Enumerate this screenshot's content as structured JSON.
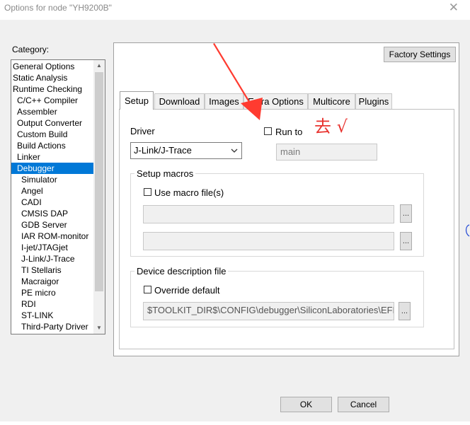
{
  "window": {
    "title": "Options for node \"YH9200B\"",
    "close_symbol": "✕"
  },
  "category": {
    "label": "Category:",
    "items": [
      {
        "label": "General Options",
        "indent": 0
      },
      {
        "label": "Static Analysis",
        "indent": 0
      },
      {
        "label": "Runtime Checking",
        "indent": 0
      },
      {
        "label": "C/C++ Compiler",
        "indent": 1
      },
      {
        "label": "Assembler",
        "indent": 1
      },
      {
        "label": "Output Converter",
        "indent": 1
      },
      {
        "label": "Custom Build",
        "indent": 1
      },
      {
        "label": "Build Actions",
        "indent": 1
      },
      {
        "label": "Linker",
        "indent": 1
      },
      {
        "label": "Debugger",
        "indent": 1,
        "selected": true
      },
      {
        "label": "Simulator",
        "indent": 2
      },
      {
        "label": "Angel",
        "indent": 2
      },
      {
        "label": "CADI",
        "indent": 2
      },
      {
        "label": "CMSIS DAP",
        "indent": 2
      },
      {
        "label": "GDB Server",
        "indent": 2
      },
      {
        "label": "IAR ROM-monitor",
        "indent": 2
      },
      {
        "label": "I-jet/JTAGjet",
        "indent": 2
      },
      {
        "label": "J-Link/J-Trace",
        "indent": 2
      },
      {
        "label": "TI Stellaris",
        "indent": 2
      },
      {
        "label": "Macraigor",
        "indent": 2
      },
      {
        "label": "PE micro",
        "indent": 2
      },
      {
        "label": "RDI",
        "indent": 2
      },
      {
        "label": "ST-LINK",
        "indent": 2
      },
      {
        "label": "Third-Party Driver",
        "indent": 2
      }
    ]
  },
  "factory_settings_label": "Factory Settings",
  "tabs": [
    {
      "label": "Setup",
      "active": true
    },
    {
      "label": "Download"
    },
    {
      "label": "Images"
    },
    {
      "label": "Extra Options"
    },
    {
      "label": "Multicore"
    },
    {
      "label": "Plugins"
    }
  ],
  "setup": {
    "driver_label": "Driver",
    "driver_value": "J-Link/J-Trace",
    "run_to_label": "Run to",
    "run_to_checked": false,
    "run_to_value": "main",
    "setup_macros_title": "Setup macros",
    "use_macro_label": "Use macro file(s)",
    "use_macro_checked": false,
    "macro_file_1": "",
    "macro_file_2": "",
    "device_desc_title": "Device description file",
    "override_label": "Override default",
    "override_checked": false,
    "device_file_path": "$TOOLKIT_DIR$\\CONFIG\\debugger\\SiliconLaboratories\\EFM",
    "browse_label": "..."
  },
  "annotation": {
    "text": "去 √",
    "color": "#e8322e"
  },
  "buttons": {
    "ok": "OK",
    "cancel": "Cancel"
  }
}
